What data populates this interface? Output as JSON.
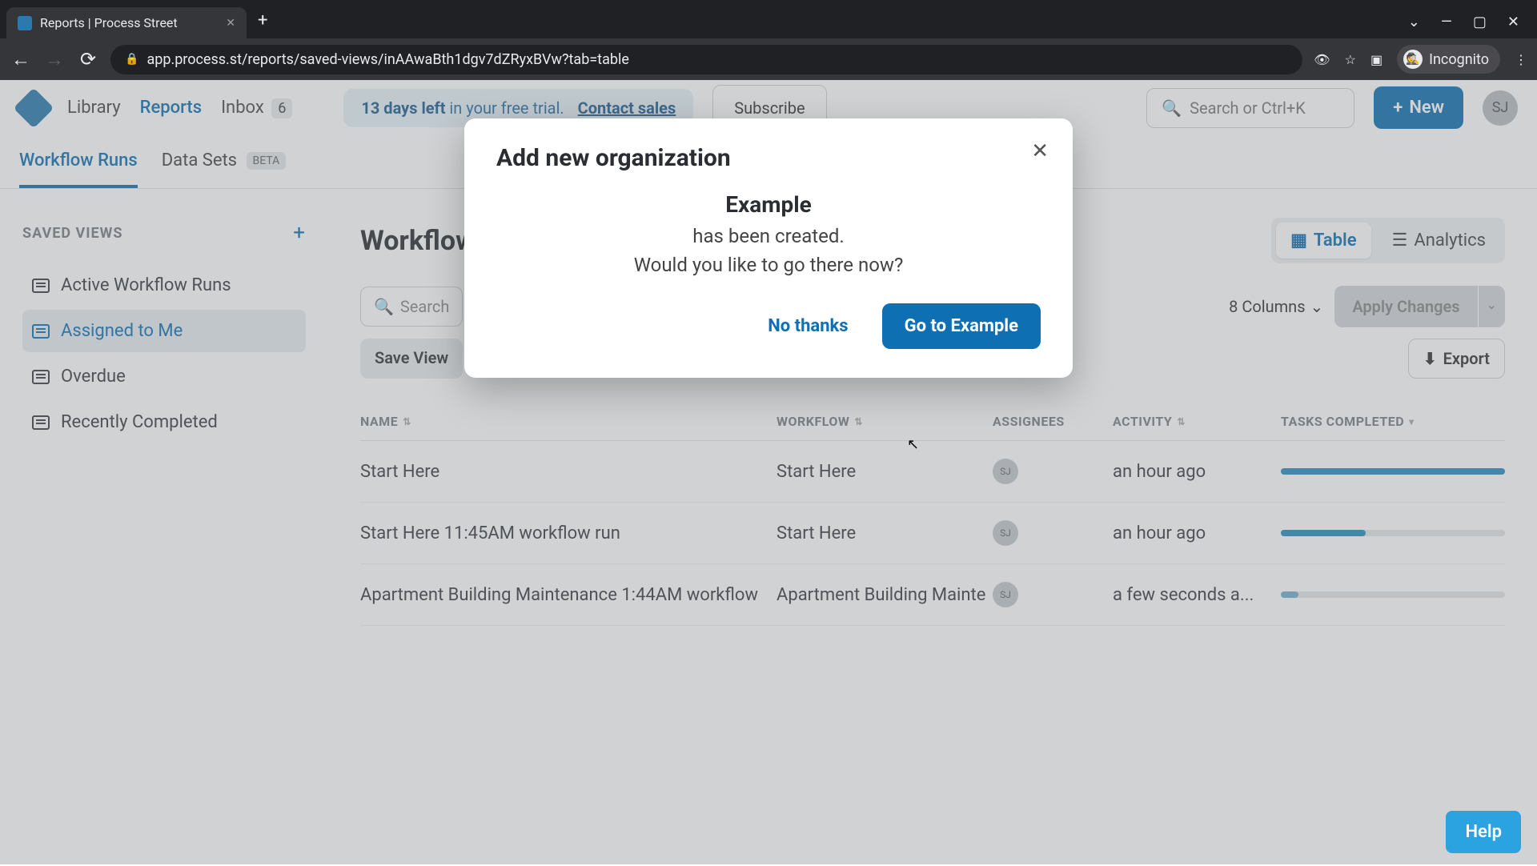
{
  "browser": {
    "tab_title": "Reports | Process Street",
    "url": "app.process.st/reports/saved-views/inAAwaBth1dgv7dZRyxBVw?tab=table",
    "incognito_label": "Incognito"
  },
  "header": {
    "nav": {
      "library": "Library",
      "reports": "Reports",
      "inbox": "Inbox",
      "inbox_count": "6"
    },
    "trial": {
      "days": "13 days left",
      "rest": " in your free trial.",
      "contact": "Contact sales"
    },
    "subscribe": "Subscribe",
    "search_placeholder": "Search or Ctrl+K",
    "new_label": "New",
    "avatar": "SJ"
  },
  "subnav": {
    "runs": "Workflow Runs",
    "datasets": "Data Sets",
    "beta": "BETA"
  },
  "sidebar": {
    "title": "SAVED VIEWS",
    "items": [
      "Active Workflow Runs",
      "Assigned to Me",
      "Overdue",
      "Recently Completed"
    ]
  },
  "main": {
    "title": "Workflow Runs",
    "toggle": {
      "table": "Table",
      "analytics": "Analytics"
    },
    "search_placeholder": "Search",
    "columns": "8 Columns",
    "apply": "Apply Changes",
    "save_view": "Save View",
    "export": "Export",
    "table": {
      "headers": {
        "name": "NAME",
        "workflow": "WORKFLOW",
        "assignees": "ASSIGNEES",
        "activity": "ACTIVITY",
        "tasks": "TASKS COMPLETED"
      },
      "rows": [
        {
          "name": "Start Here",
          "workflow": "Start Here",
          "assignee": "SJ",
          "activity": "an hour ago",
          "progress": 100
        },
        {
          "name": "Start Here 11:45AM workflow run",
          "workflow": "Start Here",
          "assignee": "SJ",
          "activity": "an hour ago",
          "progress": 38
        },
        {
          "name": "Apartment Building Maintenance 1:44AM workflow",
          "workflow": "Apartment Building Mainte",
          "assignee": "SJ",
          "activity": "a few seconds a...",
          "progress": 8
        }
      ]
    }
  },
  "modal": {
    "title": "Add new organization",
    "org_name": "Example",
    "line1": "has been created.",
    "line2": "Would you like to go there now?",
    "no": "No thanks",
    "go": "Go to Example"
  },
  "help": "Help"
}
